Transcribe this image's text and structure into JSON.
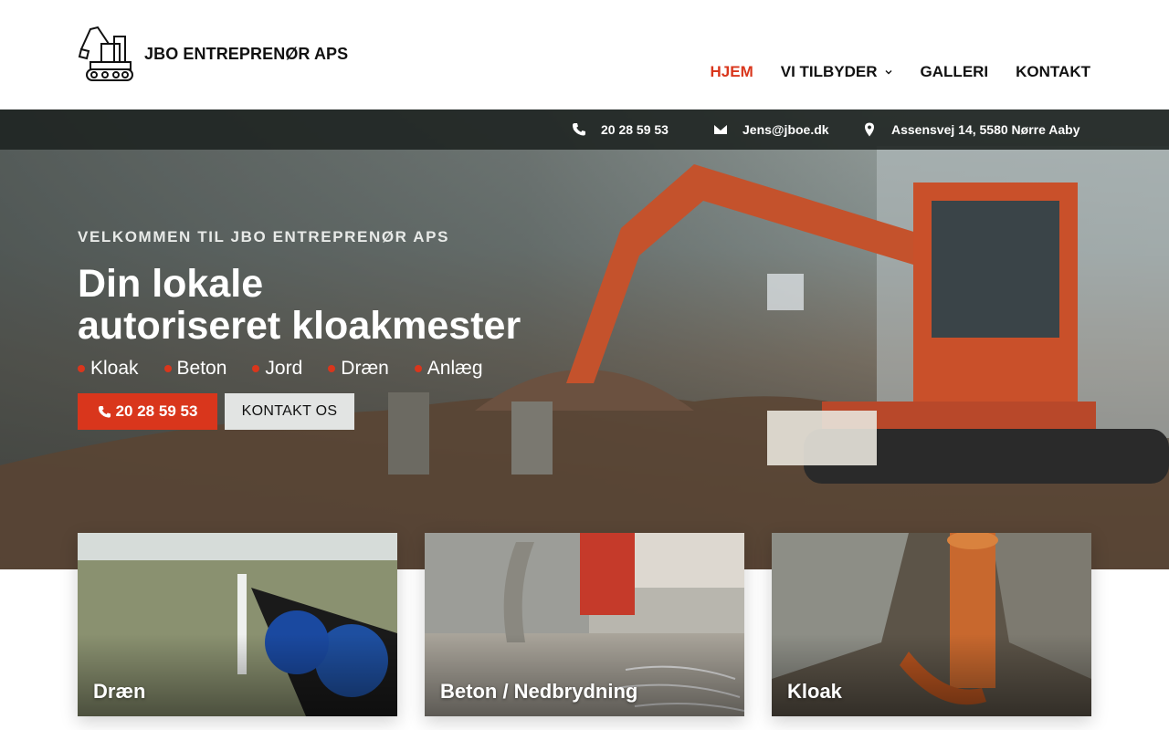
{
  "header": {
    "logo_text": "JBO ENTREPRENØR APS",
    "nav": [
      {
        "label": "HJEM",
        "active": true
      },
      {
        "label": "VI TILBYDER",
        "has_dropdown": true
      },
      {
        "label": "GALLERI"
      },
      {
        "label": "KONTAKT"
      }
    ]
  },
  "topbar": {
    "phone": "20 28 59 53",
    "email": "Jens@jboe.dk",
    "address": "Assensvej 14, 5580 Nørre Aaby"
  },
  "hero": {
    "kicker": "VELKOMMEN TIL JBO ENTREPRENØR APS",
    "headline_line1": "Din lokale",
    "headline_line2": "autoriseret kloakmester",
    "bullets": [
      "Kloak",
      "Beton",
      "Jord",
      "Dræn",
      "Anlæg"
    ],
    "call_button": "20 28 59 53",
    "contact_button": "KONTAKT OS"
  },
  "cards": [
    {
      "label": "Dræn"
    },
    {
      "label": "Beton / Nedbrydning"
    },
    {
      "label": "Kloak"
    }
  ],
  "colors": {
    "accent": "#d9361c",
    "topbar_bg": "#1c2220",
    "text": "#111111"
  },
  "icons": {
    "logo": "excavator-logo",
    "phone": "phone-icon",
    "email": "envelope-icon",
    "address": "map-pin-icon",
    "dropdown": "chevron-down-icon"
  }
}
